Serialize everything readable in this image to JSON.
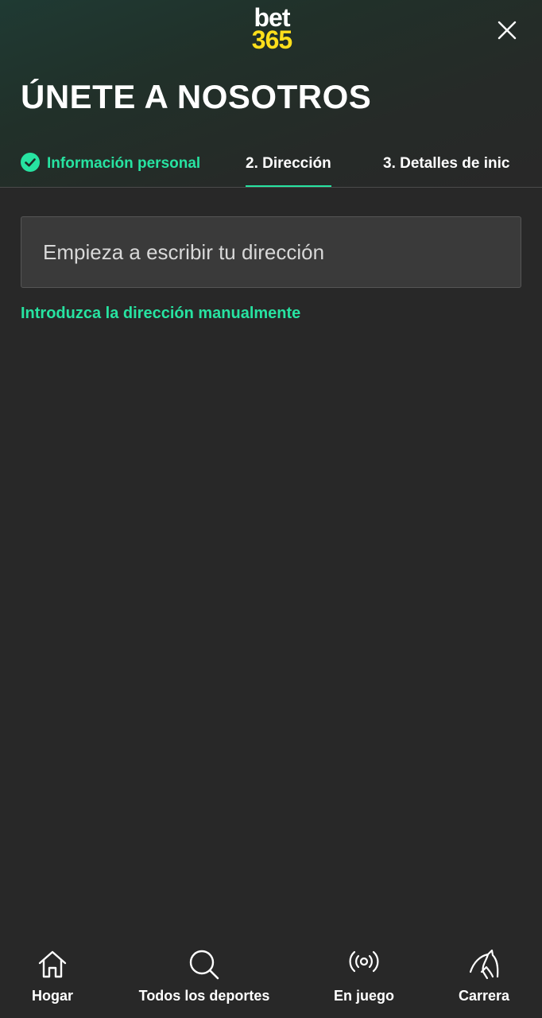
{
  "brand": {
    "logo_line1": "bet",
    "logo_line2": "365",
    "logo_color_top": "#ffffff",
    "logo_color_bottom": "#ffdf1b",
    "accent_color": "#27e3a1",
    "background_color": "#282828"
  },
  "header": {
    "title": "ÚNETE A NOSOTROS",
    "close_icon": "close-icon"
  },
  "steps": [
    {
      "label": "Información personal",
      "status": "completed",
      "icon": "check-circle-icon"
    },
    {
      "label": "2. Dirección",
      "status": "active"
    },
    {
      "label": "3. Detalles de inic",
      "status": "pending"
    }
  ],
  "address_form": {
    "input_placeholder": "Empieza a escribir tu dirección",
    "input_value": "",
    "manual_link": "Introduzca la dirección manualmente"
  },
  "bottom_nav": [
    {
      "label": "Hogar",
      "icon": "home-icon"
    },
    {
      "label": "Todos los deportes",
      "icon": "search-icon"
    },
    {
      "label": "En juego",
      "icon": "live-broadcast-icon"
    },
    {
      "label": "Carrera",
      "icon": "horse-icon"
    }
  ]
}
